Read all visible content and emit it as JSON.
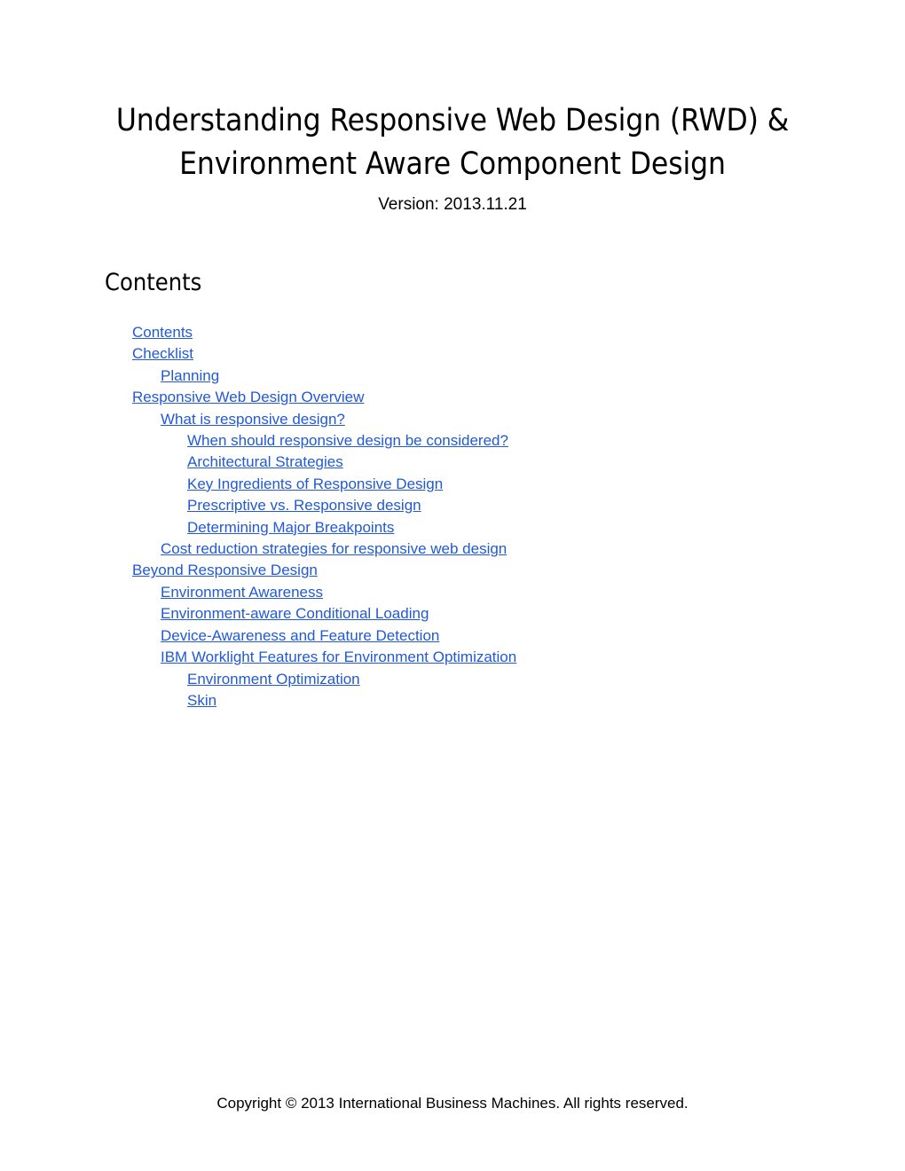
{
  "document": {
    "title_line_1": "Understanding Responsive Web Design (RWD) &",
    "title_line_2": "Environment Aware Component Design",
    "version": "Version: 2013.11.21"
  },
  "contents": {
    "heading": "Contents",
    "link_color": "#2159d6",
    "entries": [
      {
        "label": "Contents",
        "level": 0
      },
      {
        "label": "Checklist",
        "level": 0
      },
      {
        "label": "Planning",
        "level": 1
      },
      {
        "label": "Responsive Web Design Overview",
        "level": 0
      },
      {
        "label": "What is responsive design?",
        "level": 1
      },
      {
        "label": "When should responsive design be considered?",
        "level": 2
      },
      {
        "label": "Architectural Strategies",
        "level": 2
      },
      {
        "label": "Key Ingredients of Responsive Design",
        "level": 2
      },
      {
        "label": "Prescriptive vs. Responsive design",
        "level": 2
      },
      {
        "label": "Determining Major Breakpoints",
        "level": 2
      },
      {
        "label": "Cost reduction strategies for responsive web design",
        "level": 1
      },
      {
        "label": "Beyond Responsive Design",
        "level": 0
      },
      {
        "label": "Environment Awareness",
        "level": 1
      },
      {
        "label": "Environment-aware Conditional Loading",
        "level": 1
      },
      {
        "label": "Device-Awareness and Feature Detection",
        "level": 1
      },
      {
        "label": "IBM Worklight Features for Environment Optimization",
        "level": 1
      },
      {
        "label": "Environment Optimization",
        "level": 2
      },
      {
        "label": "Skin",
        "level": 2
      }
    ]
  },
  "footer": {
    "copyright": "Copyright © 2013 International Business Machines. All rights reserved."
  }
}
